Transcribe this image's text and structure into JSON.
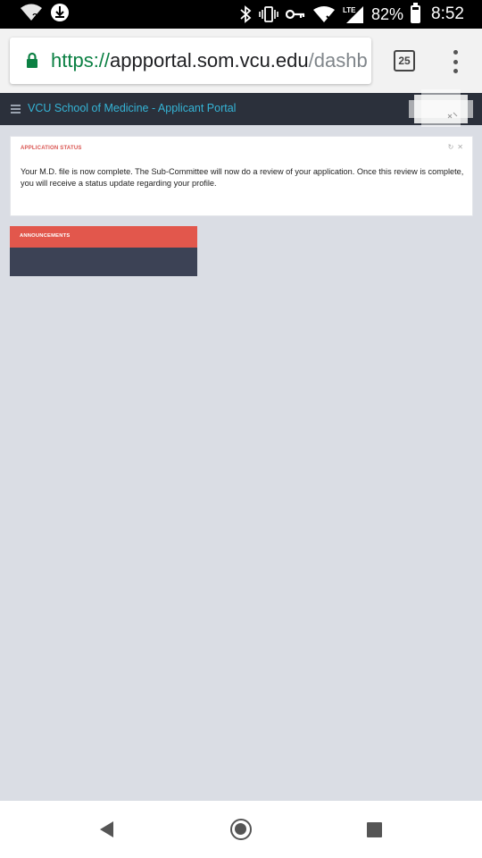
{
  "status_bar": {
    "battery_percent": "82%",
    "time": "8:52",
    "network_label": "LTE",
    "icons": [
      "wifi-unknown-icon",
      "download-icon",
      "bluetooth-icon",
      "vibrate-icon",
      "vpn-key-icon",
      "wifi-x-icon",
      "lte-signal-icon",
      "battery-icon"
    ]
  },
  "browser": {
    "url_scheme": "https://",
    "url_host": "appportal.som.vcu.edu",
    "url_path": "/dashb",
    "tab_count": "25"
  },
  "app_header": {
    "title": "VCU School of Medicine - Applicant Portal",
    "title_color": "#35b4d6",
    "background": "#2b303b"
  },
  "status_panel": {
    "title": "APPLICATION STATUS",
    "message": "Your M.D. file is now complete. The Sub-Committee will now do a review of your application. Once this review is complete, you will receive a status update regarding your profile."
  },
  "announcements": {
    "title": "ANNOUNCEMENTS",
    "header_color": "#e2574c",
    "body_color": "#3c4255"
  },
  "colors": {
    "page_background": "#dadde4",
    "accent_red": "#d9534f",
    "secure_green": "#0b8043"
  }
}
